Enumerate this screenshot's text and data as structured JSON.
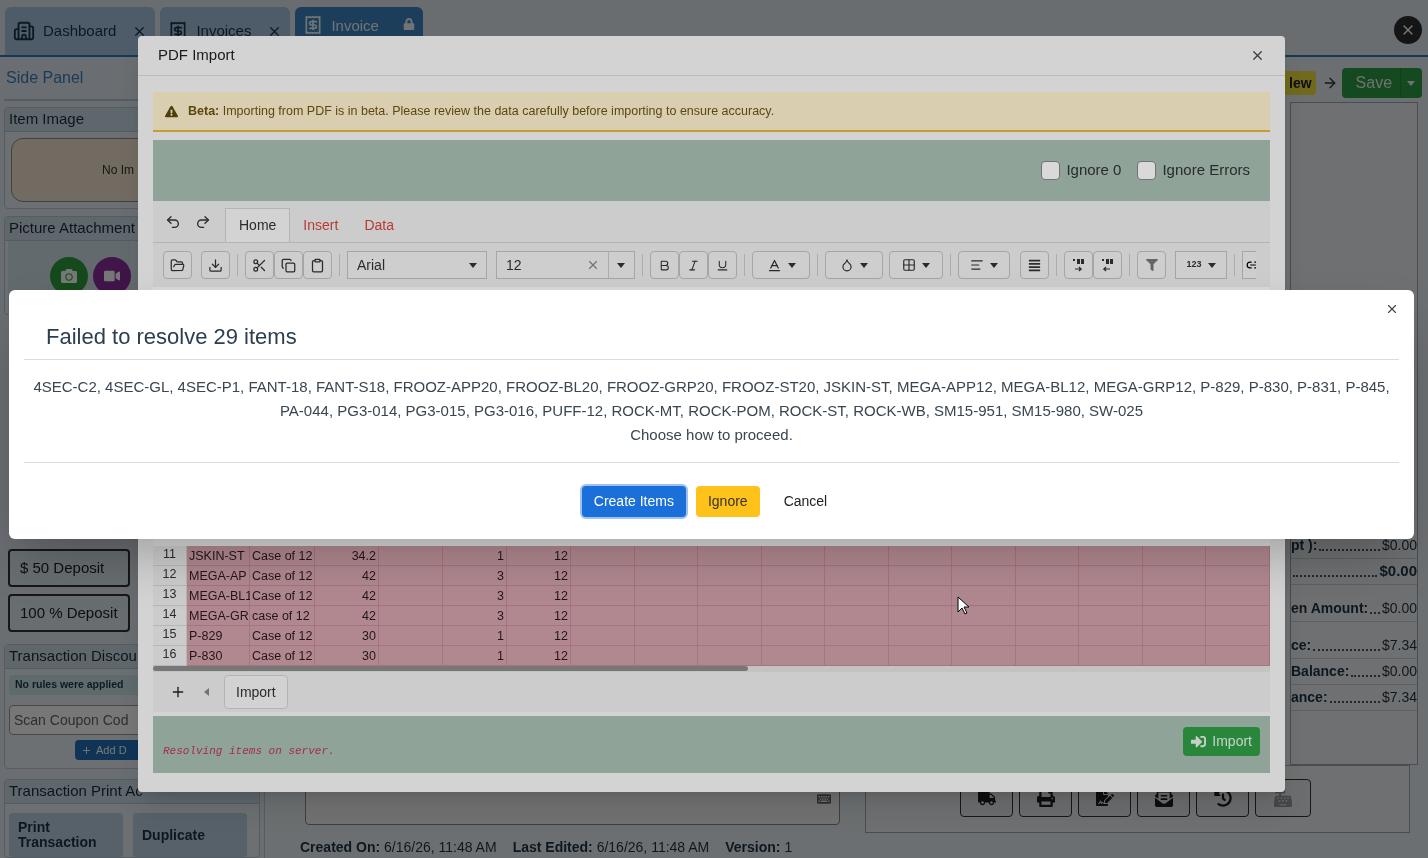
{
  "app_tabs": [
    {
      "label": "Dashboard",
      "kind": "closable",
      "selected": false
    },
    {
      "label": "Invoices",
      "kind": "closable",
      "selected": false
    },
    {
      "label": "Invoice",
      "kind": "locked",
      "selected": true
    }
  ],
  "side_panel": {
    "title": "Side Panel",
    "item_image": {
      "title": "Item Image",
      "placeholder_text": "No Im"
    },
    "picture_attachments": {
      "title": "Picture Attachment"
    },
    "deposit_buttons": [
      "$ 50 Deposit",
      "100 % Deposit"
    ],
    "discounts": {
      "title": "Transaction Discou",
      "notice": "No rules were applied",
      "coupon_placeholder": "Scan Coupon Cod",
      "add_button": "Add D"
    },
    "print_actions": {
      "title": "Transaction Print Ac",
      "buttons": [
        "Print Transaction",
        "Duplicate"
      ]
    }
  },
  "status_badge": "lew",
  "save_button": "Save",
  "totals": [
    {
      "label": "pt ):",
      "value": "$0.00",
      "emphasis": false
    },
    {
      "value": "$0.00",
      "emphasis": true
    },
    {
      "label": "en Amount:",
      "value": "$0.00",
      "emphasis": false
    },
    {
      "label": "ce:",
      "value": "$7.34",
      "emphasis": false
    },
    {
      "label": "Balance:",
      "value": "$0.00",
      "emphasis": false
    },
    {
      "label": "ance:",
      "value": "$7.34",
      "emphasis": false
    }
  ],
  "record_meta": [
    {
      "label": "Created On:",
      "value": "6/16/26, 11:48 AM"
    },
    {
      "label": "Last Edited:",
      "value": "6/16/26, 11:48 AM"
    },
    {
      "label": "Version:",
      "value": "1"
    }
  ],
  "pdf_import": {
    "title": "PDF Import",
    "alert": "**Beta:** Importing from PDF is in beta. Please review the data carefully before importing to ensure accuracy.",
    "options": [
      {
        "label": "Ignore 0",
        "checked": false
      },
      {
        "label": "Ignore Errors",
        "checked": false
      }
    ],
    "ribbon_tabs": [
      {
        "label": "Home",
        "selected": true
      },
      {
        "label": "Insert",
        "selected": false
      },
      {
        "label": "Data",
        "selected": false
      }
    ],
    "font_name": "Arial",
    "font_size": "12",
    "number_format": "123",
    "rows": [
      {
        "number": "11",
        "column_1": "JSKIN-ST",
        "column_2": "Case of 12",
        "column_3": "34.2",
        "column_5": "1",
        "column_6": "12"
      },
      {
        "number": "12",
        "column_1": "MEGA-AP",
        "column_2": "Case of 12",
        "column_3": "42",
        "column_5": "3",
        "column_6": "12"
      },
      {
        "number": "13",
        "column_1": "MEGA-BL1",
        "column_2": "Case of 12",
        "column_3": "42",
        "column_5": "3",
        "column_6": "12"
      },
      {
        "number": "14",
        "column_1": "MEGA-GR",
        "column_2": "case of 12",
        "column_3": "42",
        "column_5": "3",
        "column_6": "12"
      },
      {
        "number": "15",
        "column_1": "P-829",
        "column_2": "Case of 12",
        "column_3": "30",
        "column_5": "1",
        "column_6": "12"
      },
      {
        "number": "16",
        "column_1": "P-830",
        "column_2": "Case of 12",
        "column_3": "30",
        "column_5": "1",
        "column_6": "12"
      }
    ],
    "sheet_tabs": [
      {
        "label": "Import",
        "selected": true
      }
    ],
    "status": "Resolving items on server.",
    "import_button": "Import"
  },
  "resolve_dialog": {
    "title": "Failed to resolve 29 items",
    "items_text": "4SEC-C2, 4SEC-GL, 4SEC-P1, FANT-18, FANT-S18, FROOZ-APP20, FROOZ-BL20, FROOZ-GRP20, FROOZ-ST20, JSKIN-ST, MEGA-APP12, MEGA-BL12, MEGA-GRP12, P-829, P-830, P-831, P-845, PA-044, PG3-014, PG3-015, PG3-016, PUFF-12, ROCK-MT, ROCK-POM, ROCK-ST, ROCK-WB, SM15-951, SM15-980, SW-025",
    "prompt": "Choose how to proceed.",
    "buttons": [
      {
        "label": "Create Items",
        "kind": "primary"
      },
      {
        "label": "Ignore",
        "kind": "warning"
      },
      {
        "label": "Cancel",
        "kind": "link"
      }
    ]
  }
}
